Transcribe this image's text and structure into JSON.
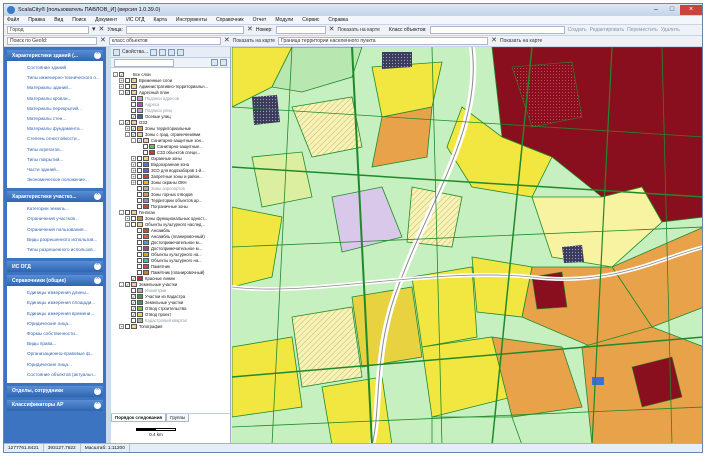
{
  "window": {
    "title": "ScalaCity® [пользователь ПАВЛОВ_И] (версия 1.0.39.0)"
  },
  "menu": [
    "Файл",
    "Правка",
    "Вид",
    "Поиск",
    "Документ",
    "ИС ОГД",
    "Карта",
    "Инструменты",
    "Справочник",
    "Отчет",
    "Модули",
    "Сервис",
    "Справка"
  ],
  "toolbar1": {
    "city_value": "Город",
    "street_label": "Улица:",
    "number_label": "Номер:",
    "show_on_map": "Показать на карте",
    "object_class_label": "Класс объектов:",
    "create": "Создать",
    "edit": "Редактировать",
    "move": "Переместить",
    "delete": "Удалить"
  },
  "toolbar2": {
    "geoid_value": "Поиск по GeoId:",
    "object_class": "класс объектов",
    "show_on_map": "Показать на карте",
    "boundary_value": "Граница территории населенного пункта",
    "show_on_map2": "Показать на карте"
  },
  "sections": [
    {
      "title": "Характеристики зданий (...",
      "items": [
        "Состояние зданий",
        "Типы инженерно-технического о...",
        "Материалы зданий...",
        "Материалы кровли...",
        "Материалы перекрытий...",
        "Материалы стен...",
        "Материалы фундамента...",
        "Степень огнестойкости...",
        "Типы агрегатов...",
        "Типы покрытий...",
        "Части зданий...",
        "Экономическое положение..."
      ]
    },
    {
      "title": "Характеристики участко...",
      "items": [
        "Категории земель...",
        "Ограничения участков...",
        "Ограничения пользования...",
        "Виды разрешенного использов...",
        "Типы разрешенного использов..."
      ]
    },
    {
      "title": "ИС ОГД",
      "items": []
    },
    {
      "title": "Справочники (общие)",
      "items": [
        "Единицы измерения длины...",
        "Единицы измерения площади...",
        "Единицы измерения времени...",
        "Юридические лица...",
        "Формы собственности...",
        "Виды права...",
        "Организационно-правовые ф...",
        "Юридические лица...",
        "Состояние объектов (актуальн..."
      ]
    },
    {
      "title": "Отделы, сотрудники",
      "items": []
    },
    {
      "title": "Классификаторы АР",
      "items": []
    }
  ],
  "tree": {
    "toolbar_label": "Свойства...",
    "rows": [
      {
        "indent": 0,
        "text": "Все слои",
        "exp": "-",
        "check": "✓",
        "color": ""
      },
      {
        "indent": 1,
        "text": "Временные слои",
        "exp": "+",
        "check": "",
        "color": "#f0d38a"
      },
      {
        "indent": 1,
        "text": "Административно-территориальн...",
        "exp": "+",
        "check": "",
        "color": "#f0d38a"
      },
      {
        "indent": 1,
        "text": "Адресный план",
        "exp": "-",
        "check": "✓",
        "color": "#f0d38a"
      },
      {
        "indent": 2,
        "text": "Подписи адресов",
        "exp": "",
        "check": "",
        "color": "#c8a0e0",
        "grey": true
      },
      {
        "indent": 2,
        "text": "Адреса",
        "exp": "",
        "check": "",
        "color": "#d040d0",
        "grey": true
      },
      {
        "indent": 2,
        "text": "Подписи улиц",
        "exp": "",
        "check": "",
        "color": "#b0b0b0",
        "grey": true
      },
      {
        "indent": 2,
        "text": "Осевые улиц",
        "exp": "",
        "check": "✓",
        "color": "#4060c0"
      },
      {
        "indent": 1,
        "text": "ОЗЗ",
        "exp": "-",
        "check": "✓",
        "color": "#f0d38a"
      },
      {
        "indent": 2,
        "text": "Зоны территориальные",
        "exp": "+",
        "check": "✓",
        "color": "#e0a040"
      },
      {
        "indent": 2,
        "text": "Зоны с град. ограничениями",
        "exp": "-",
        "check": "✓",
        "color": "#f0d38a"
      },
      {
        "indent": 3,
        "text": "Санитарно-защитные зон...",
        "exp": "-",
        "check": "✓",
        "color": "#f0d38a"
      },
      {
        "indent": 4,
        "text": "Санитарно-защитные...",
        "exp": "",
        "check": "",
        "color": "#60c060"
      },
      {
        "indent": 4,
        "text": "СЗЗ объектов специ...",
        "exp": "",
        "check": "",
        "color": "#c04040"
      },
      {
        "indent": 3,
        "text": "Охранные зоны",
        "exp": "+",
        "check": "",
        "color": "#f0d38a"
      },
      {
        "indent": 3,
        "text": "Водоохранная зона",
        "exp": "+",
        "check": "",
        "color": "#4080e0"
      },
      {
        "indent": 3,
        "text": "ЗСО для водозаборов 1-й...",
        "exp": "+",
        "check": "",
        "color": "#6060d0"
      },
      {
        "indent": 3,
        "text": "Запретные зоны и район...",
        "exp": "+",
        "check": "",
        "color": "#d04040"
      },
      {
        "indent": 3,
        "text": "Зоны охраны ОКН",
        "exp": "+",
        "check": "",
        "color": "#e0c020"
      },
      {
        "indent": 3,
        "text": "Зоны аэропортов",
        "exp": "",
        "check": "",
        "color": "#b0b0b0",
        "grey": true
      },
      {
        "indent": 3,
        "text": "Зоны горных отводов",
        "exp": "",
        "check": "",
        "color": "#c0a060"
      },
      {
        "indent": 3,
        "text": "Территории объектов ар...",
        "exp": "",
        "check": "",
        "color": "#a080c0"
      },
      {
        "indent": 3,
        "text": "Пограничные зоны",
        "exp": "",
        "check": "",
        "color": "#d04040"
      },
      {
        "indent": 1,
        "text": "Генплан",
        "exp": "-",
        "check": "",
        "color": "#f0d38a"
      },
      {
        "indent": 2,
        "text": "Зоны функциональных одност...",
        "exp": "+",
        "check": "",
        "color": "#e09030"
      },
      {
        "indent": 2,
        "text": "Объекты культурного наслед...",
        "exp": "-",
        "check": "",
        "color": "#f0d38a"
      },
      {
        "indent": 3,
        "text": "Ансамбль",
        "exp": "",
        "check": "",
        "color": "#e04040"
      },
      {
        "indent": 3,
        "text": "Ансамбль (планировочный)",
        "exp": "",
        "check": "",
        "color": "#e06040"
      },
      {
        "indent": 3,
        "text": "Достопримечательное м...",
        "exp": "",
        "check": "",
        "color": "#40a0e0"
      },
      {
        "indent": 3,
        "text": "Достопримечательное м...",
        "exp": "",
        "check": "",
        "color": "#a040c0"
      },
      {
        "indent": 3,
        "text": "Объекты культурного на...",
        "exp": "",
        "check": "",
        "color": "#e0a020"
      },
      {
        "indent": 3,
        "text": "Объекты культурного на...",
        "exp": "",
        "check": "",
        "color": "#40c0a0"
      },
      {
        "indent": 3,
        "text": "Памятник",
        "exp": "",
        "check": "",
        "color": "#e04040"
      },
      {
        "indent": 3,
        "text": "Памятник (планировочный)",
        "exp": "",
        "check": "",
        "color": "#c08040"
      },
      {
        "indent": 2,
        "text": "Красные линии",
        "exp": "",
        "check": "✓",
        "color": "#e02020"
      },
      {
        "indent": 1,
        "text": "Земельные участки",
        "exp": "-",
        "check": "✓",
        "color": "#f0d38a"
      },
      {
        "indent": 2,
        "text": "Изометрии",
        "exp": "",
        "check": "",
        "color": "#b0b0b0",
        "grey": true
      },
      {
        "indent": 2,
        "text": "Участки из Кадастра",
        "exp": "",
        "check": "✓",
        "color": "#40a040"
      },
      {
        "indent": 2,
        "text": "Земельные участки",
        "exp": "",
        "check": "✓",
        "color": "#40a040"
      },
      {
        "indent": 2,
        "text": "Отвод строительства",
        "exp": "",
        "check": "✓",
        "color": "#80c040"
      },
      {
        "indent": 2,
        "text": "Отвод проект",
        "exp": "",
        "check": "✓",
        "color": "#e0e040"
      },
      {
        "indent": 2,
        "text": "Кадастровый квартал",
        "exp": "",
        "check": "",
        "color": "#b0b0b0",
        "grey": true
      },
      {
        "indent": 1,
        "text": "Топография",
        "exp": "+",
        "check": "",
        "color": "#f0d38a"
      }
    ],
    "tabs": [
      "Порядок следования",
      "Группы"
    ],
    "scale_label": "0.4 km"
  },
  "status": {
    "x": "1277761.8421",
    "y": "393127.7622",
    "scale": "Масштаб: 1:11200"
  },
  "colors": {
    "accent": "#3d74c2",
    "map_green": "#c6f0c0",
    "map_yellow": "#f2e640",
    "map_orange": "#e8a24a",
    "map_darkred": "#8a0f1e",
    "map_outline": "#1f8a2a"
  }
}
